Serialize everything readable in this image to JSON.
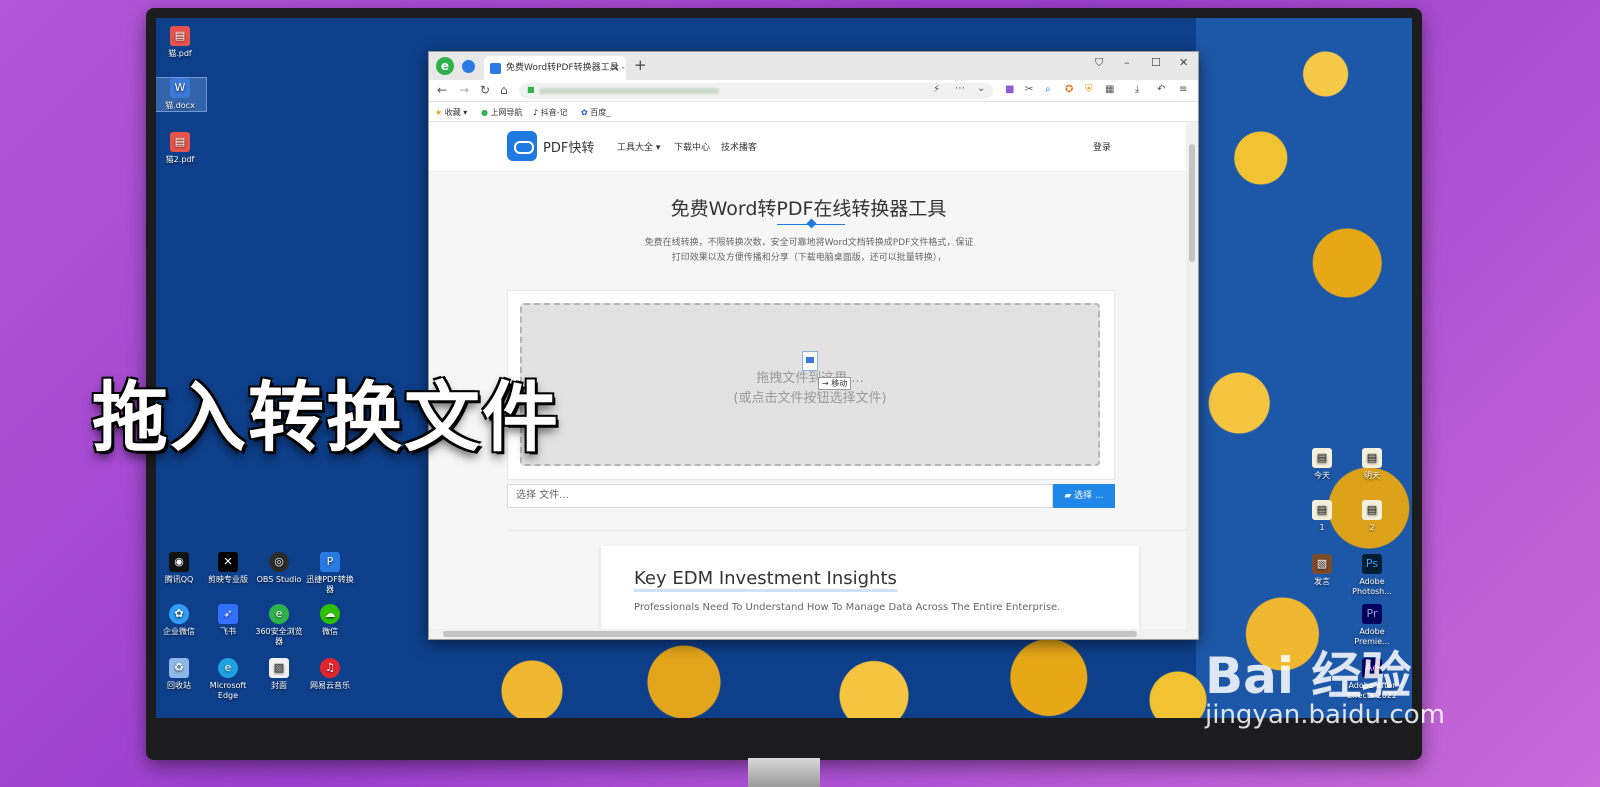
{
  "overlay": {
    "caption": "拖入转换文件",
    "watermark_main": "Bai 经验",
    "watermark_sub": "jingyan.baidu.com"
  },
  "desktop": {
    "left_icons": [
      {
        "label": "猫.pdf"
      },
      {
        "label": "猫.docx"
      },
      {
        "label": "猫2.pdf"
      }
    ],
    "bottom_icons": [
      {
        "label": "腾讯QQ"
      },
      {
        "label": "剪映专业版"
      },
      {
        "label": "OBS Studio"
      },
      {
        "label": "迅捷PDF转换器"
      },
      {
        "label": "企业微信"
      },
      {
        "label": "飞书"
      },
      {
        "label": "360安全浏览器"
      },
      {
        "label": "微信"
      },
      {
        "label": "回收站"
      },
      {
        "label": "Microsoft Edge"
      },
      {
        "label": "封面"
      },
      {
        "label": "网易云音乐"
      }
    ],
    "right_icons": [
      {
        "label": "今天"
      },
      {
        "label": "明天"
      },
      {
        "label": "1"
      },
      {
        "label": "2"
      },
      {
        "label": "发言"
      },
      {
        "label": "Adobe Photosh..."
      },
      {
        "label": "Adobe Premie..."
      },
      {
        "label": "Adobe After Effects 2022"
      }
    ]
  },
  "browser": {
    "tab_title": "免费Word转PDF转换器工具 -",
    "bookmarks": [
      "收藏",
      "上网导航",
      "抖音-记",
      "百度_"
    ],
    "page": {
      "site_name": "PDF快转",
      "nav": [
        "工具大全 ▾",
        "下载中心",
        "技术播客"
      ],
      "login": "登录",
      "title": "免费Word转PDF在线转换器工具",
      "desc_line1": "免费在线转换，不限转换次数，安全可靠地将Word文档转换成PDF文件格式，保证",
      "desc_line2": "打印效果以及方便传播和分享（下载电脑桌面版，还可以批量转换），",
      "drop_line1": "拖拽文件到这里 ...",
      "drop_line2": "(或点击文件按钮选择文件)",
      "drag_tip": "→ 移动",
      "file_placeholder": "选择 文件...",
      "choose_button": "选择 ...",
      "ad_title": "Key EDM Investment Insights",
      "ad_subtitle": "Professionals Need To Understand How To Manage Data Across The Entire Enterprise."
    }
  },
  "colors": {
    "accent": "#1f87e8",
    "desktop_bg": "#0e3f8a",
    "backdrop": "#b357d6"
  }
}
